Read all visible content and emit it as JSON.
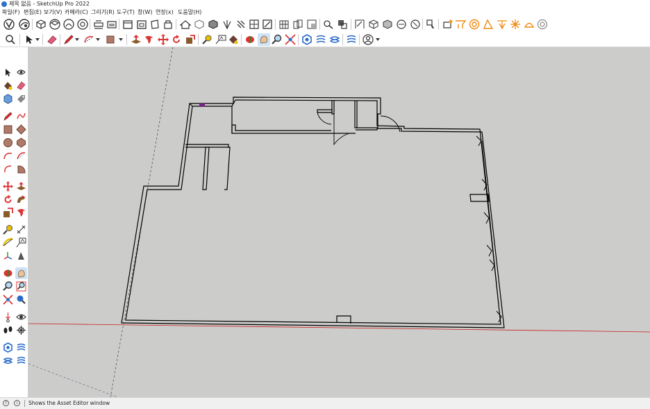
{
  "window": {
    "title": "제목 없음 - SketchUp Pro 2022"
  },
  "menu": [
    {
      "id": "file",
      "label": "파일(F)"
    },
    {
      "id": "edit",
      "label": "편집(E)"
    },
    {
      "id": "view",
      "label": "보기(V)"
    },
    {
      "id": "camera",
      "label": "카메라(C)"
    },
    {
      "id": "draw",
      "label": "그리기(R)"
    },
    {
      "id": "tools",
      "label": "도구(T)"
    },
    {
      "id": "window",
      "label": "창(W)"
    },
    {
      "id": "extensions",
      "label": "연장(x)"
    },
    {
      "id": "help",
      "label": "도움말(H)"
    }
  ],
  "icons": {
    "toolbar1": [
      "model-info-icon",
      "styles-icon",
      "iso-view-icon",
      "top-view-icon",
      "front-view-icon",
      "right-view-icon",
      "back-view-icon",
      "left-view-icon",
      "bottom-view-icon",
      "section-plane-icon",
      "section-display-icon",
      "xray-icon",
      "back-edges-icon",
      "wireframe-icon",
      "hidden-line-icon",
      "shaded-icon",
      "shaded-texture-icon",
      "monochrome-icon",
      "warehouse-icon",
      "extension-warehouse-icon",
      "layout-icon",
      "sandbox-icon",
      "solid-union-icon",
      "solid-subtract-icon",
      "outer-shell-icon",
      "intersect-icon",
      "trim-icon",
      "split-icon",
      "camera-position-icon",
      "sun-icon",
      "fog-icon",
      "shadow-icon"
    ],
    "toolbar2": [
      "search-icon",
      "select-icon",
      "eraser-icon",
      "pencil-icon",
      "arc-icon",
      "rectangle-icon",
      "push-pull-icon",
      "offset-icon",
      "move-icon",
      "rotate-icon",
      "scale-icon",
      "tape-measure-icon",
      "text-icon",
      "paint-bucket-icon",
      "orbit-icon",
      "pan-icon",
      "zoom-icon",
      "zoom-extents-icon",
      "warehouse-icon",
      "extension-warehouse-icon",
      "extension-manager-icon",
      "asset-editor-icon",
      "account-icon"
    ]
  },
  "status": {
    "hint": "Shows the Asset Editor window",
    "left_icons": [
      "help-circle-icon",
      "info-circle-icon"
    ]
  },
  "colors": {
    "viewport_bg": "#cccccb",
    "red_axis": "#c8201f",
    "model_line": "#000000"
  }
}
